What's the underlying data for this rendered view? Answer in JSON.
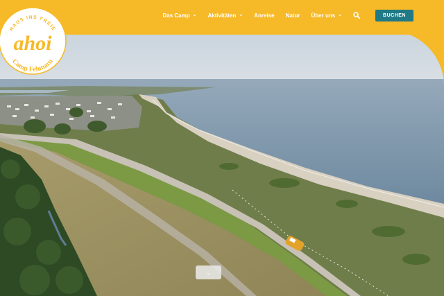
{
  "brand": {
    "name": "ahoi",
    "tagline_top": "RAUS INS FREIE",
    "tagline_bottom": "Camp Fehmarn"
  },
  "nav": {
    "items": [
      {
        "label": "Das Camp",
        "has_dropdown": true
      },
      {
        "label": "Aktivitäten",
        "has_dropdown": true
      },
      {
        "label": "Anreise",
        "has_dropdown": false
      },
      {
        "label": "Natur",
        "has_dropdown": false
      },
      {
        "label": "Über uns",
        "has_dropdown": true
      }
    ],
    "search_icon": "search-icon",
    "book_label": "BUCHEN"
  },
  "hero": {
    "scroll_icon": "chevron-down-icon",
    "scroll_glyph": "⌄"
  },
  "colors": {
    "brand_yellow": "#f6b928",
    "button_teal": "#1f7a86"
  }
}
